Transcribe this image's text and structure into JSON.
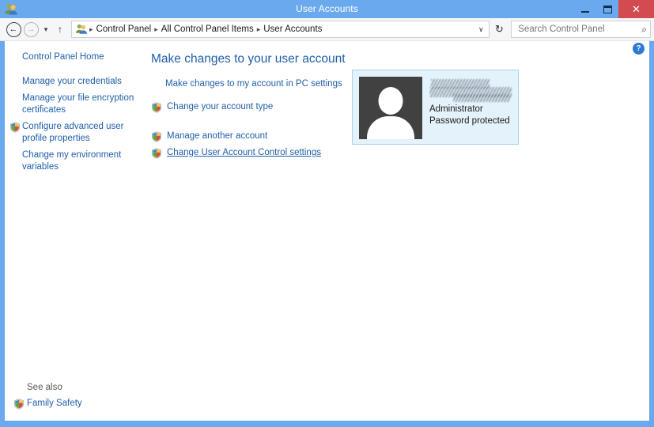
{
  "window": {
    "title": "User Accounts",
    "icon": "user-accounts-icon",
    "minimize_label": "Minimize",
    "maximize_label": "Maximize",
    "close_label": "✕"
  },
  "nav": {
    "back_label": "←",
    "forward_label": "→",
    "recent_label": "▾",
    "up_label": "↑",
    "dropdown_label": "∨",
    "refresh_label": "↻",
    "separator": "▸",
    "breadcrumbs": [
      {
        "label": "Control Panel"
      },
      {
        "label": "All Control Panel Items"
      },
      {
        "label": "User Accounts"
      }
    ]
  },
  "search": {
    "placeholder": "Search Control Panel",
    "value": "",
    "icon_label": "⌕"
  },
  "sidebar": {
    "home_label": "Control Panel Home",
    "items": [
      {
        "label": "Manage your credentials",
        "shield": false
      },
      {
        "label": "Manage your file encryption certificates",
        "shield": false
      },
      {
        "label": "Configure advanced user profile properties",
        "shield": true
      },
      {
        "label": "Change my environment variables",
        "shield": false
      }
    ],
    "see_also_title": "See also",
    "see_also_items": [
      {
        "label": "Family Safety",
        "shield": true
      }
    ]
  },
  "main": {
    "page_title": "Make changes to your user account",
    "pc_settings_link": "Make changes to my account in PC settings",
    "tasks_group_one": [
      {
        "label": "Change your account type",
        "shield": true,
        "underlined": false
      }
    ],
    "tasks_group_two": [
      {
        "label": "Manage another account",
        "shield": true,
        "underlined": false
      },
      {
        "label": "Change User Account Control settings",
        "shield": true,
        "underlined": true
      }
    ],
    "account": {
      "name_redacted": true,
      "account_type": "Administrator",
      "password_status": "Password protected",
      "avatar_label": "default-user-avatar"
    },
    "help_label": "?"
  },
  "colors": {
    "window_frame": "#6aa9ee",
    "close_button": "#d14b50",
    "link": "#1f5fa9",
    "title_text": "#1f5fa9",
    "account_tile_bg": "#e4f2fb",
    "account_tile_border": "#a8d4ec",
    "navbar_bg": "#f5f6f7",
    "help_badge": "#2a7ad3"
  }
}
